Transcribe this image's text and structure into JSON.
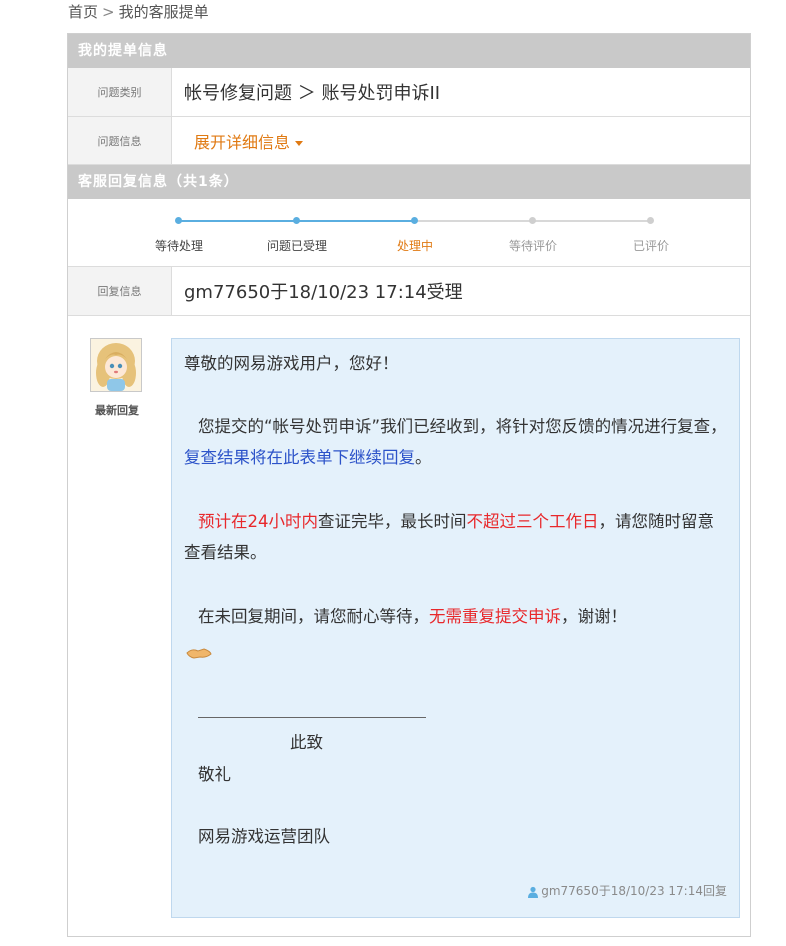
{
  "breadcrumb": {
    "home": "首页",
    "separator": ">",
    "current": "我的客服提单"
  },
  "ticket_info": {
    "header": "我的提单信息",
    "category_label": "问题类别",
    "category_value": "帐号修复问题 ＞ 账号处罚申诉II",
    "detail_label": "问题信息",
    "detail_link": "展开详细信息"
  },
  "service_reply": {
    "header": "客服回复信息（共1条）",
    "steps": [
      {
        "label": "等待处理",
        "state": "done"
      },
      {
        "label": "问题已受理",
        "state": "done"
      },
      {
        "label": "处理中",
        "state": "current"
      },
      {
        "label": "等待评价",
        "state": "pending"
      },
      {
        "label": "已评价",
        "state": "pending"
      }
    ],
    "reply_info_label": "回复信息",
    "reply_info_value": "gm77650于18/10/23 17:14受理"
  },
  "reply": {
    "avatar_caption": "最新回复",
    "greeting": "尊敬的网易游戏用户，您好！",
    "para1_a": "您提交的“帐号处罚申诉”我们已经收到，将针对您反馈的情况进行复查，",
    "para1_b": "复查结果将在此表单下继续回复",
    "para1_c": "。",
    "para2_a": "预计在24小时内",
    "para2_b": "查证完毕，最长时间",
    "para2_c": "不超过三个工作日",
    "para2_d": "，请您随时留意查看结果。",
    "para3_a": "在未回复期间，请您耐心等待，",
    "para3_b": "无需重复提交申诉",
    "para3_c": "，谢谢！",
    "closing_1": "此致",
    "closing_2": "敬礼",
    "signature": "网易游戏运营团队",
    "meta": "gm77650于18/10/23 17:14回复"
  },
  "colors": {
    "accent_orange": "#e07a13",
    "progress_blue": "#5aaee0",
    "highlight_blue": "#2c53c9",
    "highlight_red": "#e8282b",
    "bubble_bg": "#e4f1fb",
    "header_gray": "#c9c9c9"
  }
}
